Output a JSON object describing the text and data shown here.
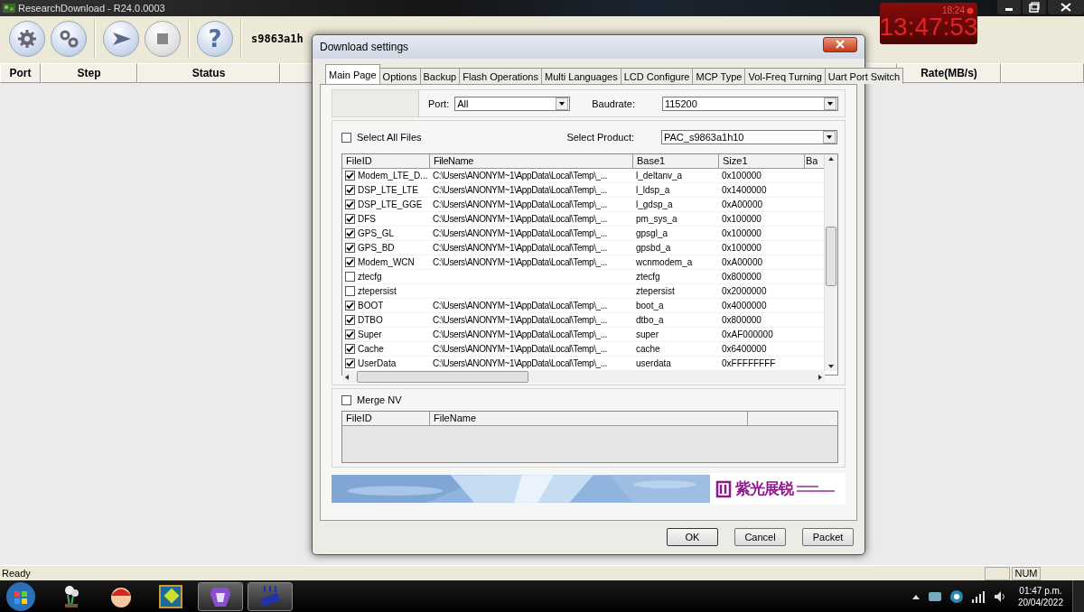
{
  "window": {
    "title": "ResearchDownload - R24.0.0003"
  },
  "toolbar": {
    "buttons": [
      {
        "kind": "settings",
        "disabled": false
      },
      {
        "kind": "gears",
        "disabled": false
      },
      {
        "kind": "start",
        "disabled": false
      },
      {
        "kind": "stop",
        "disabled": true
      },
      {
        "kind": "help",
        "label": "?",
        "disabled": false
      }
    ],
    "product": "s9863a1h"
  },
  "port_table": {
    "columns": [
      "Port",
      "Step",
      "Status",
      "Rate(MB/s)"
    ]
  },
  "clock_widget": {
    "time": "13:47:53",
    "alarm": "18:24"
  },
  "dialog": {
    "title": "Download settings",
    "tabs": [
      {
        "label": "Main Page",
        "selected": true
      },
      {
        "label": "Options",
        "selected": false
      },
      {
        "label": "Backup",
        "selected": false
      },
      {
        "label": "Flash Operations",
        "selected": false
      },
      {
        "label": "Multi Languages",
        "selected": false
      },
      {
        "label": "LCD Configure",
        "selected": false
      },
      {
        "label": "MCP Type",
        "selected": false
      },
      {
        "label": "Vol-Freq Turning",
        "selected": false
      },
      {
        "label": "Uart Port Switch",
        "selected": false
      }
    ],
    "port": {
      "label": "Port:",
      "value": "All"
    },
    "baudrate": {
      "label": "Baudrate:",
      "value": "115200"
    },
    "select_all": {
      "label": "Select All Files",
      "checked": false
    },
    "product": {
      "label": "Select Product:",
      "value": "PAC_s9863a1h10"
    },
    "files": {
      "columns": [
        "FileID",
        "FileName",
        "Base1",
        "Size1",
        "Ba"
      ],
      "rows": [
        {
          "checked": true,
          "file_id": "Modem_LTE_D...",
          "file_name": "C:\\Users\\ANONYM~1\\AppData\\Local\\Temp\\_...",
          "base": "l_deltanv_a",
          "size": "0x100000"
        },
        {
          "checked": true,
          "file_id": "DSP_LTE_LTE",
          "file_name": "C:\\Users\\ANONYM~1\\AppData\\Local\\Temp\\_...",
          "base": "l_ldsp_a",
          "size": "0x1400000"
        },
        {
          "checked": true,
          "file_id": "DSP_LTE_GGE",
          "file_name": "C:\\Users\\ANONYM~1\\AppData\\Local\\Temp\\_...",
          "base": "l_gdsp_a",
          "size": "0xA00000"
        },
        {
          "checked": true,
          "file_id": "DFS",
          "file_name": "C:\\Users\\ANONYM~1\\AppData\\Local\\Temp\\_...",
          "base": "pm_sys_a",
          "size": "0x100000"
        },
        {
          "checked": true,
          "file_id": "GPS_GL",
          "file_name": "C:\\Users\\ANONYM~1\\AppData\\Local\\Temp\\_...",
          "base": "gpsgl_a",
          "size": "0x100000"
        },
        {
          "checked": true,
          "file_id": "GPS_BD",
          "file_name": "C:\\Users\\ANONYM~1\\AppData\\Local\\Temp\\_...",
          "base": "gpsbd_a",
          "size": "0x100000"
        },
        {
          "checked": true,
          "file_id": "Modem_WCN",
          "file_name": "C:\\Users\\ANONYM~1\\AppData\\Local\\Temp\\_...",
          "base": "wcnmodem_a",
          "size": "0xA00000"
        },
        {
          "checked": false,
          "file_id": "ztecfg",
          "base": "ztecfg",
          "size": "0x800000"
        },
        {
          "checked": false,
          "file_id": "ztepersist",
          "base": "ztepersist",
          "size": "0x2000000"
        },
        {
          "checked": true,
          "file_id": "BOOT",
          "file_name": "C:\\Users\\ANONYM~1\\AppData\\Local\\Temp\\_...",
          "base": "boot_a",
          "size": "0x4000000"
        },
        {
          "checked": true,
          "file_id": "DTBO",
          "file_name": "C:\\Users\\ANONYM~1\\AppData\\Local\\Temp\\_...",
          "base": "dtbo_a",
          "size": "0x800000"
        },
        {
          "checked": true,
          "file_id": "Super",
          "file_name": "C:\\Users\\ANONYM~1\\AppData\\Local\\Temp\\_...",
          "base": "super",
          "size": "0xAF000000"
        },
        {
          "checked": true,
          "file_id": "Cache",
          "file_name": "C:\\Users\\ANONYM~1\\AppData\\Local\\Temp\\_...",
          "base": "cache",
          "size": "0x6400000"
        },
        {
          "checked": true,
          "file_id": "UserData",
          "file_name": "C:\\Users\\ANONYM~1\\AppData\\Local\\Temp\\_...",
          "base": "userdata",
          "size": "0xFFFFFFFF"
        }
      ]
    },
    "merge_nv": {
      "label": "Merge NV",
      "checked": false,
      "columns": [
        "FileID",
        "FileName"
      ]
    },
    "banner": {
      "logo": "紫光展锐"
    },
    "buttons": [
      "OK",
      "Cancel",
      "Packet"
    ]
  },
  "status_bar": {
    "text": "Ready",
    "indicators": [
      "NUM"
    ]
  },
  "taskbar": {
    "apps": [
      {
        "kind": "plant",
        "active": false
      },
      {
        "kind": "cap",
        "active": false
      },
      {
        "kind": "game",
        "active": false
      },
      {
        "kind": "lion",
        "active": true
      },
      {
        "kind": "chip",
        "active": true
      }
    ],
    "clock": {
      "time": "01:47 p.m.",
      "date": "20/04/2022"
    }
  }
}
